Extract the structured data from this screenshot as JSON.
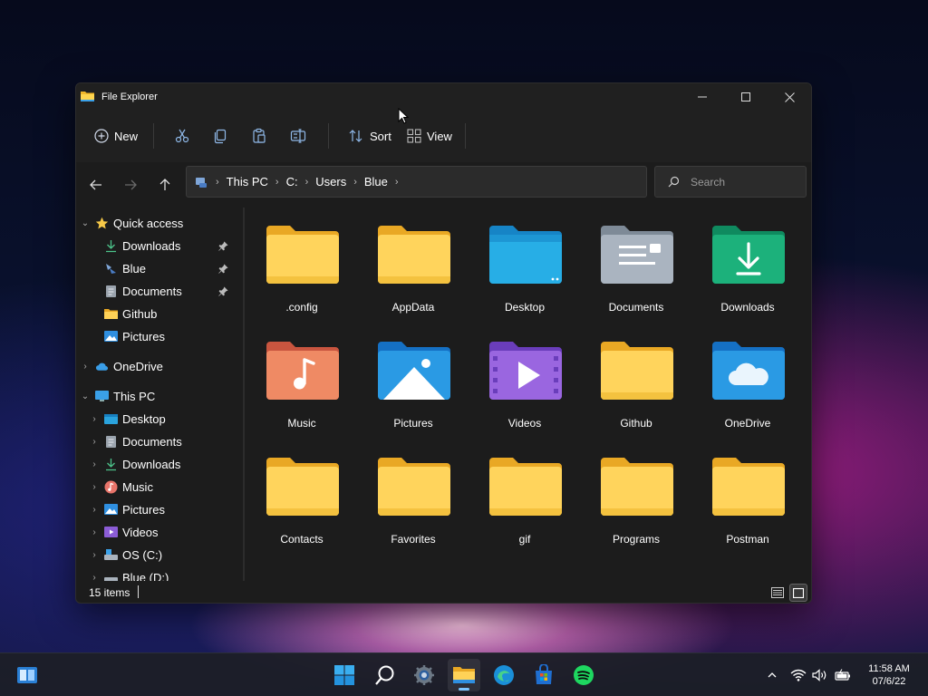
{
  "window": {
    "title": "File Explorer",
    "controls": {
      "minimize": "—",
      "maximize": "▢",
      "close": "✕"
    }
  },
  "toolbar": {
    "new_label": "New",
    "sort_label": "Sort",
    "view_label": "View",
    "icons": [
      "cut-icon",
      "copy-icon",
      "paste-icon",
      "rename-icon"
    ]
  },
  "address": {
    "crumbs": [
      "This PC",
      "C:",
      "Users",
      "Blue"
    ]
  },
  "search": {
    "placeholder": "Search"
  },
  "nav": {
    "quick_access": {
      "label": "Quick access",
      "items": [
        {
          "label": "Downloads",
          "icon": "download-icon",
          "pinned": true
        },
        {
          "label": "Blue",
          "icon": "user-folder-icon",
          "pinned": true
        },
        {
          "label": "Documents",
          "icon": "documents-icon",
          "pinned": true
        },
        {
          "label": "Github",
          "icon": "folder-icon",
          "pinned": false
        },
        {
          "label": "Pictures",
          "icon": "pictures-icon",
          "pinned": false
        }
      ]
    },
    "onedrive": {
      "label": "OneDrive"
    },
    "this_pc": {
      "label": "This PC",
      "items": [
        {
          "label": "Desktop",
          "icon": "desktop-icon"
        },
        {
          "label": "Documents",
          "icon": "documents-icon"
        },
        {
          "label": "Downloads",
          "icon": "download-icon"
        },
        {
          "label": "Music",
          "icon": "music-icon"
        },
        {
          "label": "Pictures",
          "icon": "pictures-icon"
        },
        {
          "label": "Videos",
          "icon": "videos-icon"
        },
        {
          "label": "OS (C:)",
          "icon": "drive-icon"
        },
        {
          "label": "Blue (D:)",
          "icon": "drive-icon"
        }
      ]
    }
  },
  "files": [
    {
      "name": ".config",
      "type": "folder"
    },
    {
      "name": "AppData",
      "type": "folder"
    },
    {
      "name": "Desktop",
      "type": "desktop"
    },
    {
      "name": "Documents",
      "type": "documents"
    },
    {
      "name": "Downloads",
      "type": "downloads"
    },
    {
      "name": "Music",
      "type": "music"
    },
    {
      "name": "Pictures",
      "type": "pictures"
    },
    {
      "name": "Videos",
      "type": "videos"
    },
    {
      "name": "Github",
      "type": "folder"
    },
    {
      "name": "OneDrive",
      "type": "onedrive"
    },
    {
      "name": "Contacts",
      "type": "folder"
    },
    {
      "name": "Favorites",
      "type": "folder"
    },
    {
      "name": "gif",
      "type": "folder"
    },
    {
      "name": "Programs",
      "type": "folder"
    },
    {
      "name": "Postman",
      "type": "folder"
    }
  ],
  "status": {
    "item_count": "15 items"
  },
  "taskbar": {
    "apps": [
      "widgets-icon",
      "start-icon",
      "search-icon",
      "settings-icon",
      "file-explorer-icon",
      "edge-icon",
      "store-icon",
      "spotify-icon"
    ],
    "active_app": "file-explorer-icon",
    "time": "11:58 AM",
    "date": "07/6/22"
  },
  "colors": {
    "window_bg": "#1c1c1c",
    "folder_yellow": "#f5c542",
    "accent_blue": "#3aa0e8"
  }
}
